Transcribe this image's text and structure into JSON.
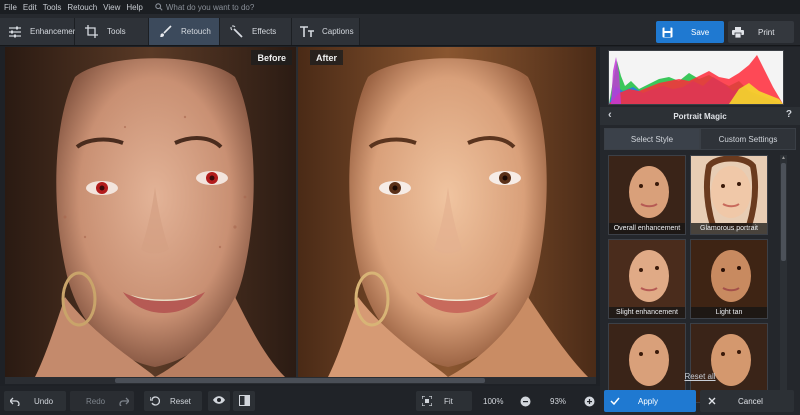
{
  "menu": [
    "File",
    "Edit",
    "Tools",
    "Retouch",
    "View",
    "Help"
  ],
  "search": {
    "placeholder": "What do you want to do?",
    "icon": "search-icon"
  },
  "tabs": [
    {
      "label": "Enhancement",
      "icon": "sliders-icon"
    },
    {
      "label": "Tools",
      "icon": "crop-icon"
    },
    {
      "label": "Retouch",
      "icon": "brush-icon",
      "active": true
    },
    {
      "label": "Effects",
      "icon": "magic-wand-icon"
    },
    {
      "label": "Captions",
      "icon": "text-icon"
    }
  ],
  "save": {
    "label": "Save",
    "icon": "floppy-icon"
  },
  "print": {
    "label": "Print",
    "icon": "printer-icon"
  },
  "canvas": {
    "before_label": "Before",
    "after_label": "After"
  },
  "panel": {
    "title": "Portrait Magic",
    "back": "‹",
    "help": "?",
    "subtabs": [
      "Select Style",
      "Custom Settings"
    ],
    "styles": [
      "Overall enhancement",
      "Glamorous portrait",
      "Slight enhancement",
      "Light tan",
      "",
      ""
    ],
    "reset_all": "Reset all"
  },
  "bottom": {
    "undo": "Undo",
    "redo": "Redo",
    "reset": "Reset",
    "fit": "Fit",
    "zoom_100": "100%",
    "zoom_value": "93%"
  },
  "apply": {
    "label": "Apply",
    "icon": "check-icon"
  },
  "cancel": {
    "label": "Cancel",
    "icon": "close-icon"
  },
  "colors": {
    "accent": "#1f79d1",
    "active_tab": "#3c4a5c",
    "background": "#1e2126"
  }
}
